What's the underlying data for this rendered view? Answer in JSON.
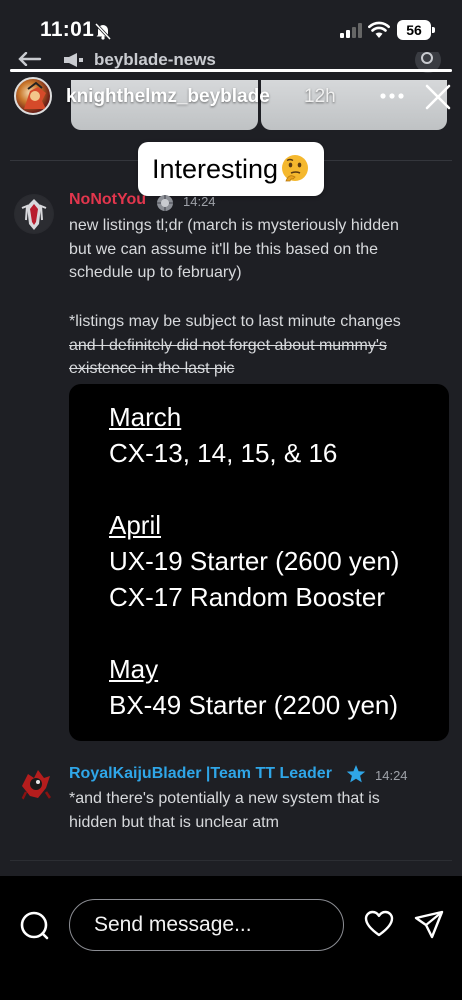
{
  "status_bar": {
    "time": "11:01",
    "battery": "56"
  },
  "channel": {
    "name": "beyblade-news"
  },
  "story": {
    "username": "knighthelmz_beyblade",
    "time": "12h",
    "progress": 1.0,
    "sticker_text": "Interesting",
    "sticker_emoji": "thinking-face"
  },
  "messages": [
    {
      "author": "NoNotYou",
      "author_color": "#e2364d",
      "time": "14:24",
      "lines": [
        "new listings tl;dr (march is mysteriously hidden",
        "but we can assume it'll be this based on the",
        "schedule up to february)"
      ],
      "note_line": "*listings may be subject to last minute changes",
      "strike_lines": [
        "and I definitely did not forget about mummy's",
        "existence in the last pic"
      ],
      "image": {
        "lines": [
          "March",
          "CX-13, 14, 15, & 16",
          "April",
          "UX-19 Starter (2600 yen)",
          "CX-17 Random Booster",
          "May",
          "BX-49 Starter (2200 yen)"
        ]
      }
    },
    {
      "author": "RoyalKaijuBlader |Team TT Leader",
      "author_color": "#2fa6e8",
      "time": "14:24",
      "lines": [
        "*and there's potentially a new system that is",
        "hidden but that is unclear atm"
      ]
    }
  ],
  "reply": {
    "placeholder": "Send message..."
  },
  "icons": {
    "bell_off": "bell-off-icon",
    "close": "close-icon",
    "more": "more-icon",
    "camera": "camera-icon",
    "heart": "heart-icon",
    "send": "send-icon"
  }
}
